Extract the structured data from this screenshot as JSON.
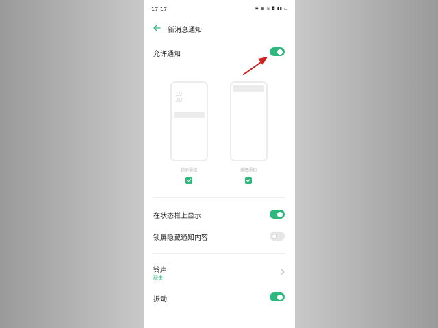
{
  "status_bar": {
    "time": "17:17",
    "icons_text": "✱ ▦ ≋ ◘ ▮▮ ▭"
  },
  "header": {
    "title": "新消息通知"
  },
  "settings": {
    "allow_notifications": {
      "label": "允许通知",
      "enabled": true
    },
    "styles": {
      "lockscreen": {
        "label": "锁屏通知",
        "clock_text": "19\n30",
        "checked": true
      },
      "banner": {
        "label": "横幅通知",
        "checked": true
      }
    },
    "status_bar_display": {
      "label": "在状态栏上显示",
      "enabled": true
    },
    "hide_lockscreen_content": {
      "label": "锁屏隐藏通知内容",
      "enabled": false
    },
    "ringtone": {
      "label": "铃声",
      "value": "敲击"
    },
    "vibration": {
      "label": "振动",
      "enabled": true
    }
  },
  "colors": {
    "accent": "#2db87d",
    "annotation_arrow": "#d11f1f"
  }
}
